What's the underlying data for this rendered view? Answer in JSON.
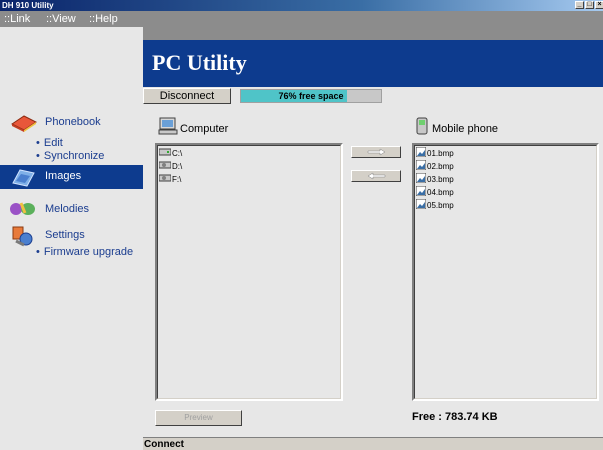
{
  "window": {
    "title": "DH 910 Utility"
  },
  "menu": {
    "items": [
      "::Link",
      "::View",
      "::Help"
    ]
  },
  "header": {
    "title": "PC Utility"
  },
  "toolbar": {
    "disconnect_label": "Disconnect",
    "free_space_text": "76% free space",
    "free_space_fraction": 0.76
  },
  "sidebar": {
    "phonebook": {
      "label": "Phonebook",
      "subitems": [
        "Edit",
        "Synchronize"
      ]
    },
    "images": {
      "label": "Images"
    },
    "melodies": {
      "label": "Melodies"
    },
    "settings": {
      "label": "Settings",
      "subitems": [
        "Firmware upgrade"
      ]
    }
  },
  "computer_pane": {
    "title": "Computer",
    "items": [
      "C:\\",
      "D:\\",
      "F:\\"
    ]
  },
  "phone_pane": {
    "title": "Mobile phone",
    "items": [
      "01.bmp",
      "02.bmp",
      "03.bmp",
      "04.bmp",
      "05.bmp"
    ],
    "free_label": "Free : 783.74 KB"
  },
  "buttons": {
    "preview_label": "Preview"
  },
  "status": {
    "text": "Connect"
  },
  "colors": {
    "accent": "#0d3b8e",
    "free_space": "#4fc4c8",
    "sidebar_text": "#1b3d8f"
  },
  "icons": {
    "window_controls": [
      "minimize-icon",
      "maximize-icon",
      "close-icon"
    ],
    "arrows": [
      "arrow-right-icon",
      "arrow-left-icon"
    ]
  }
}
